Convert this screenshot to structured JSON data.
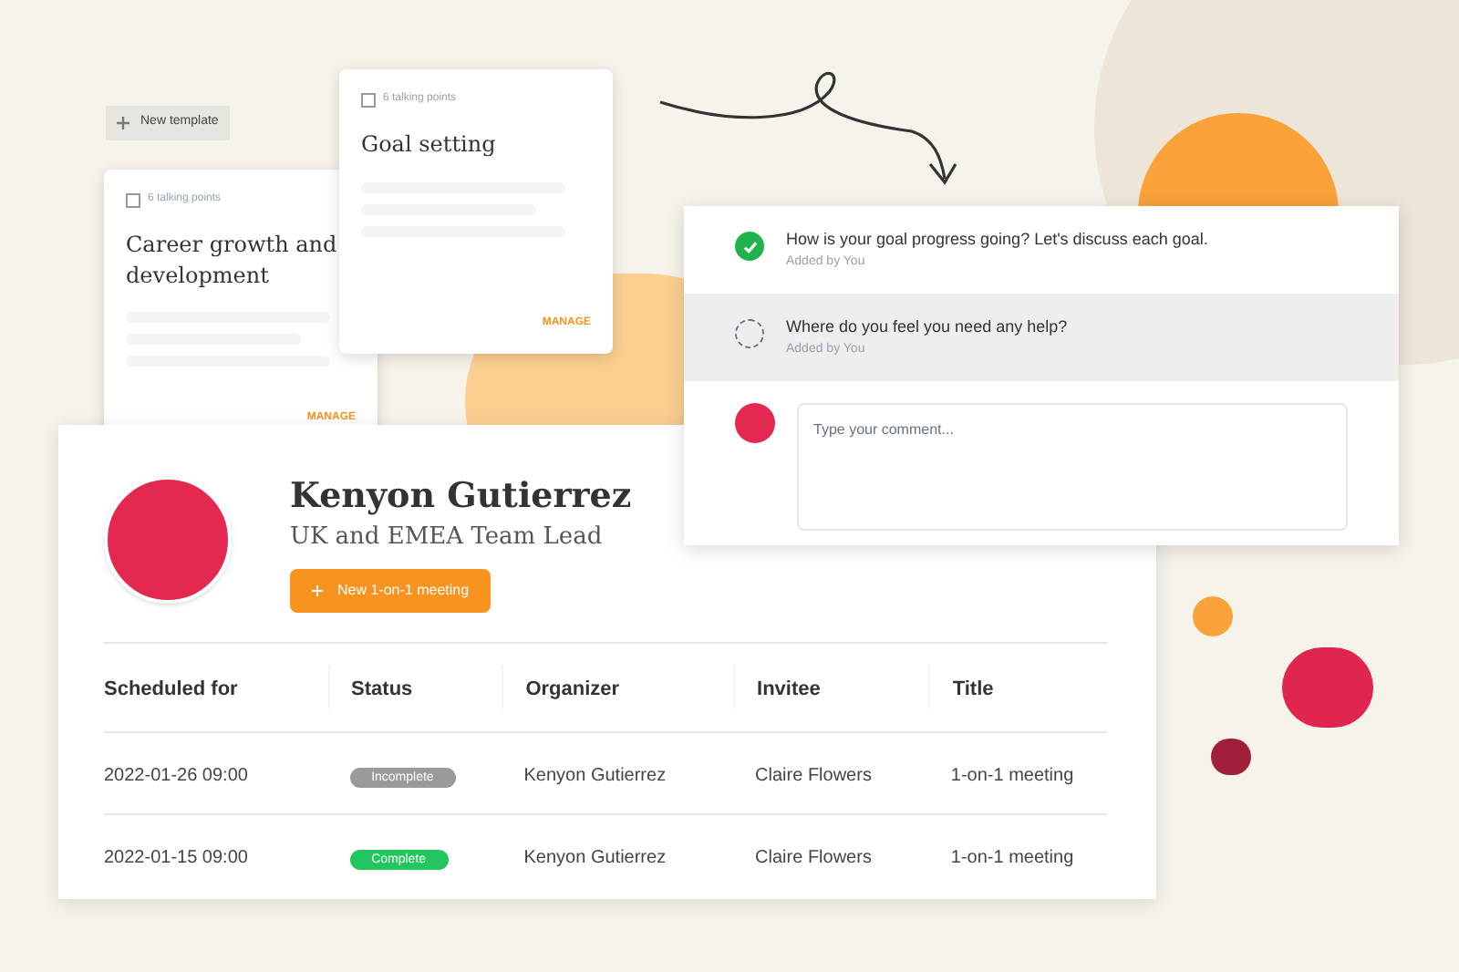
{
  "new_template_button": {
    "label": "New template"
  },
  "templates": [
    {
      "count": "6 talking points",
      "title": "Goal setting",
      "action": "MANAGE"
    },
    {
      "count": "6 talking points",
      "title": "Career growth and development",
      "action": "MANAGE"
    }
  ],
  "talking_points": [
    {
      "text": "How is your goal progress going? Let's discuss each goal.",
      "meta": "Added by You",
      "checked": true,
      "selected": false
    },
    {
      "text": "Where do you feel you need any help?",
      "meta": "Added by You",
      "checked": false,
      "selected": true
    }
  ],
  "comment": {
    "placeholder": "Type your comment..."
  },
  "profile": {
    "name": "Kenyon Gutierrez",
    "role": "UK and EMEA Team Lead",
    "button": "New 1-on-1 meeting"
  },
  "table": {
    "columns": [
      "Scheduled for",
      "Status",
      "Organizer",
      "Invitee",
      "Title"
    ],
    "rows": [
      {
        "scheduled": "2022-01-26 09:00",
        "status": {
          "label": "Incomplete",
          "kind": "incomplete"
        },
        "organizer": "Kenyon Gutierrez",
        "invitee": "Claire Flowers",
        "title": "1-on-1 meeting"
      },
      {
        "scheduled": "2022-01-15 09:00",
        "status": {
          "label": "Complete",
          "kind": "complete"
        },
        "organizer": "Kenyon Gutierrez",
        "invitee": "Claire Flowers",
        "title": "1-on-1 meeting"
      }
    ]
  }
}
